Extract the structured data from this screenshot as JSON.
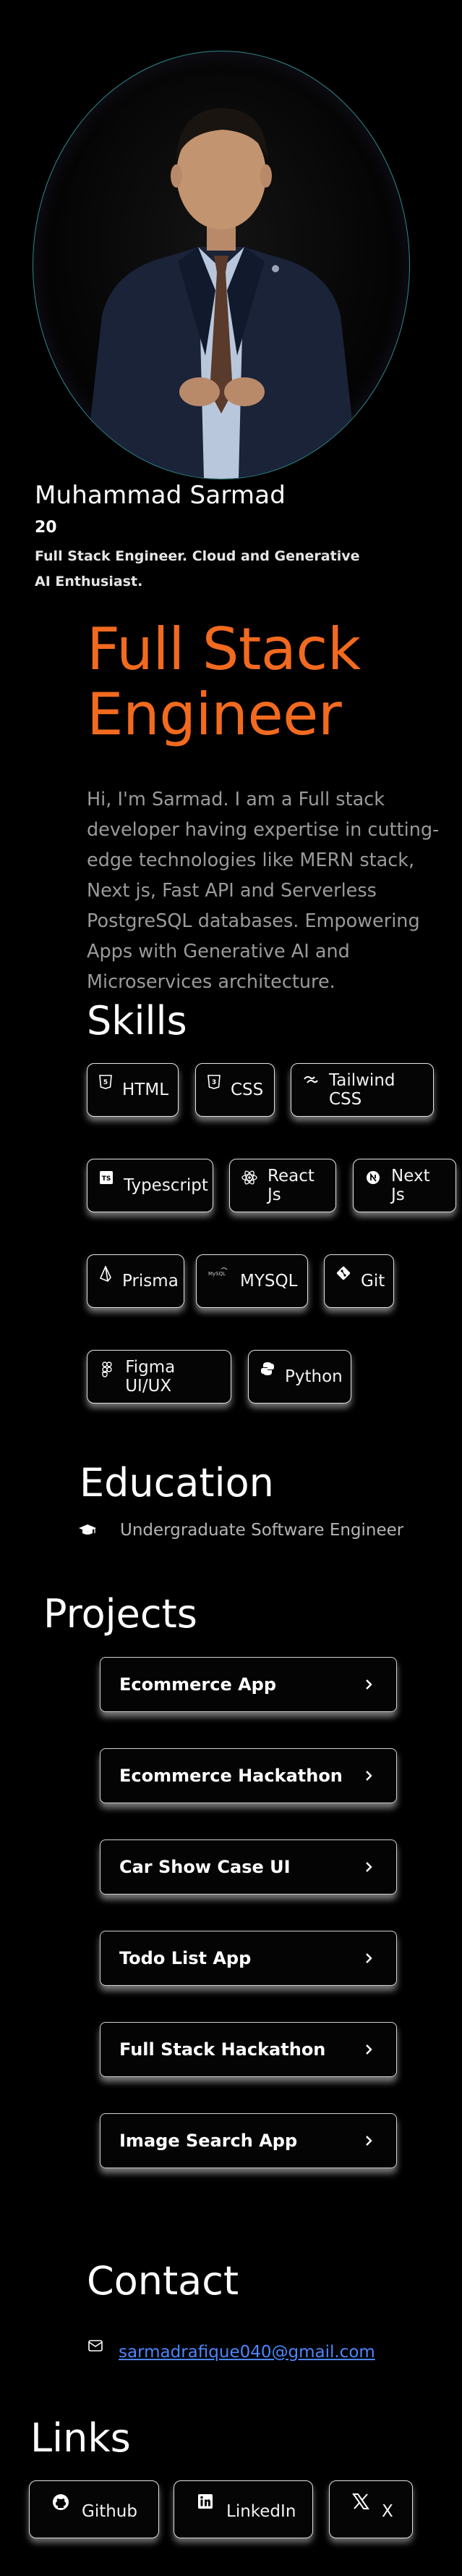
{
  "profile": {
    "name": "Muhammad Sarmad",
    "age": "20",
    "bio": "Full Stack Engineer. Cloud and Generative AI Enthusiast."
  },
  "hero": {
    "title": "Full Stack Engineer",
    "intro": "Hi, I'm Sarmad. I am a Full stack developer having expertise in cutting-edge technologies like MERN stack, Next js, Fast API and Serverless PostgreSQL databases. Empowering Apps with Generative AI and Microservices architecture."
  },
  "skills": {
    "title": "Skills",
    "items": [
      {
        "label": "HTML",
        "icon": "html-icon"
      },
      {
        "label": "CSS",
        "icon": "css-icon"
      },
      {
        "label": "Tailwind CSS",
        "icon": "tailwind-icon"
      },
      {
        "label": "Typescript",
        "icon": "typescript-icon"
      },
      {
        "label": "React Js",
        "icon": "react-icon"
      },
      {
        "label": "Next Js",
        "icon": "nextjs-icon"
      },
      {
        "label": "Prisma",
        "icon": "prisma-icon"
      },
      {
        "label": "MYSQL",
        "icon": "mysql-icon",
        "icon_text": "MySQL"
      },
      {
        "label": "Git",
        "icon": "git-icon"
      },
      {
        "label": "Figma UI/UX",
        "icon": "figma-icon"
      },
      {
        "label": "Python",
        "icon": "python-icon"
      }
    ]
  },
  "education": {
    "title": "Education",
    "item": "Undergraduate Software Engineer",
    "icon": "graduation-cap-icon"
  },
  "projects": {
    "title": "Projects",
    "items": [
      {
        "label": "Ecommerce App"
      },
      {
        "label": "Ecommerce Hackathon"
      },
      {
        "label": "Car Show Case UI"
      },
      {
        "label": "Todo List App"
      },
      {
        "label": "Full Stack Hackathon"
      },
      {
        "label": "Image Search App"
      }
    ]
  },
  "contact": {
    "title": "Contact",
    "email": "sarmadrafique040@gmail.com",
    "icon": "envelope-icon"
  },
  "links": {
    "title": "Links",
    "items": [
      {
        "label": "Github",
        "icon": "github-icon"
      },
      {
        "label": "LinkedIn",
        "icon": "linkedin-icon"
      },
      {
        "label": "X",
        "icon": "x-logo-icon"
      }
    ]
  },
  "colors": {
    "background": "#000000",
    "accent": "#f26a1f",
    "link": "#4d86ff",
    "muted_text": "#9a9a9a"
  }
}
